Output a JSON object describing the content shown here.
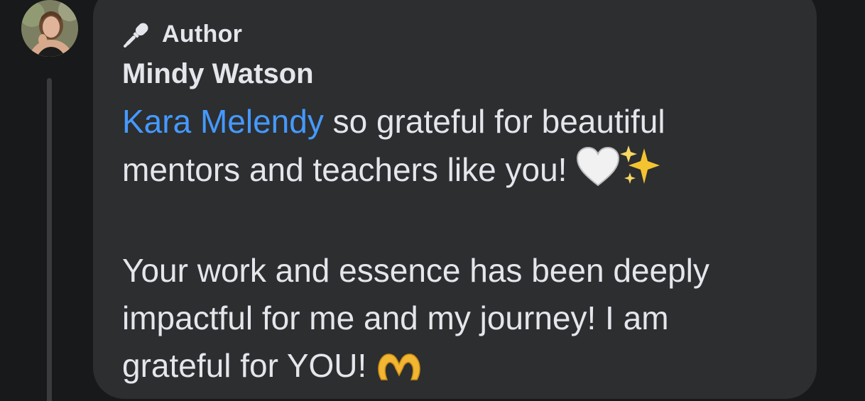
{
  "comment": {
    "badge_label": "Author",
    "badge_icon": "microphone-icon",
    "author_name": "Mindy Watson",
    "mention": "Kara Melendy",
    "line1_rest": " so grateful for beautiful",
    "line2": "mentors and teachers like you!",
    "line3": "Your work and essence has been deeply",
    "line4": "impactful for me and my journey! I am",
    "line5": "grateful for YOU!",
    "emojis": [
      "white-heart-icon",
      "sparkles-icon",
      "heart-hands-icon"
    ]
  },
  "colors": {
    "background": "#18191a",
    "bubble": "#2c2e30",
    "text": "#e4e6eb",
    "mention": "#4599ff",
    "thread_line": "#3a3b3c"
  }
}
